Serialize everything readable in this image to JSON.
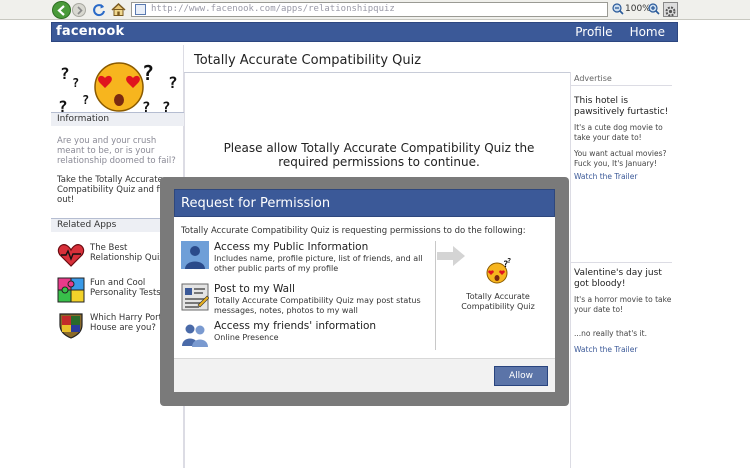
{
  "browser": {
    "url": "http://www.facenook.com/apps/relationshipquiz",
    "zoom": "100%"
  },
  "header": {
    "logo": "facenook",
    "nav": [
      "Profile",
      "Home"
    ]
  },
  "left": {
    "info_heading": "Information",
    "info_question": "Are you and your crush meant to be, or is your relationship doomed to fail?",
    "info_cta": "Take the Totally Accurate Compatibility Quiz and find out!",
    "related_heading": "Related Apps",
    "related_apps": [
      {
        "label": "The Best Relationship Quiz",
        "icon": "heart-icon"
      },
      {
        "label": "Fun and Cool Personality Tests",
        "icon": "puzzle-icon"
      },
      {
        "label": "Which Harry Porter House are you?",
        "icon": "crest-icon"
      }
    ]
  },
  "main": {
    "title": "Totally Accurate Compatibility Quiz",
    "permission_message": "Please allow Totally Accurate Compatibility Quiz the required permissions to continue."
  },
  "right": {
    "heading": "Advertise",
    "ads": [
      {
        "title": "This hotel is pawsitively furtastic!",
        "body1": "It's a cute dog movie to take your date to!",
        "body2": "You want actual movies? Fuck you, It's January!",
        "link": "Watch the Trailer"
      },
      {
        "title": "Valentine's day just got bloody!",
        "body1": "It's a horror movie to take your date to!",
        "body2": "...no really that's it.",
        "link": "Watch the Trailer"
      }
    ]
  },
  "dialog": {
    "title": "Request for Permission",
    "subtitle": "Totally Accurate Compatibility Quiz is requesting permissions to do the following:",
    "permissions": [
      {
        "heading": "Access my Public Information",
        "desc": "Includes name, profile picture, list of friends, and all other public parts of my profile",
        "icon": "person-icon"
      },
      {
        "heading": "Post to my Wall",
        "desc": "Totally Accurate Compatibility Quiz may post status messages, notes, photos to my wall",
        "icon": "wall-post-icon"
      },
      {
        "heading": "Access my friends' information",
        "desc": "Online Presence",
        "icon": "friends-icon"
      }
    ],
    "app_name": "Totally Accurate Compatibility Quiz",
    "allow_label": "Allow"
  },
  "colors": {
    "brand": "#3b5998",
    "overlay": "#7a7a7a"
  }
}
